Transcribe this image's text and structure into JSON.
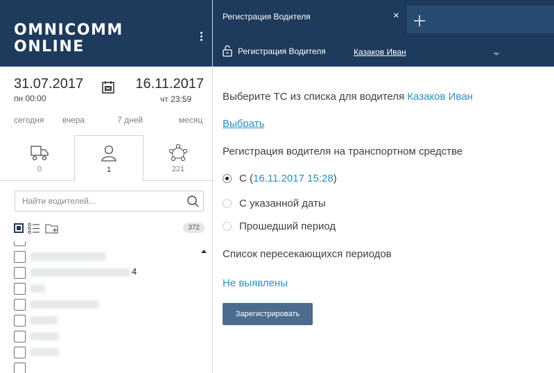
{
  "brand": {
    "line1": "OMNICOMM",
    "line2": "ONLINE"
  },
  "period": {
    "from_date": "31.07.2017",
    "from_time": "пн 00:00",
    "to_date": "16.11.2017",
    "to_time": "чт 23:59",
    "quick": [
      "сегодня",
      "вчера",
      "7 дней",
      "месяц"
    ]
  },
  "object_tabs": [
    {
      "icon": "truck-icon",
      "count": "0"
    },
    {
      "icon": "person-icon",
      "count": "1"
    },
    {
      "icon": "group-icon",
      "count": "221"
    }
  ],
  "search": {
    "placeholder": "Найти водителей..."
  },
  "list": {
    "total_badge": "372",
    "visible_tail_text": "4"
  },
  "window_tab": {
    "title": "Регистрация Водителя",
    "close": "×"
  },
  "section": {
    "title": "Регистрация Водителя",
    "driver": "Казаков Иван"
  },
  "main": {
    "choose_prefix": "Выберите ТС из списка для водителя",
    "choose_driver": "Казаков Иван",
    "choose_link": "Выбрать",
    "registration_label": "Регистрация водителя на транспортном средстве",
    "options": [
      {
        "prefix": "С (",
        "date": "16.11.2017 15:28",
        "suffix": ")",
        "selected": true
      },
      {
        "label": "С указанной даты",
        "selected": false
      },
      {
        "label": "Прошедший период",
        "selected": false
      }
    ],
    "overlap_label": "Список пересекающихся периодов",
    "overlap_value": "Не выявлены",
    "submit": "Зарегистрировать"
  },
  "colors": {
    "header": "#1e3a5c",
    "accent": "#2c8ec4",
    "button": "#4b6c8e"
  }
}
